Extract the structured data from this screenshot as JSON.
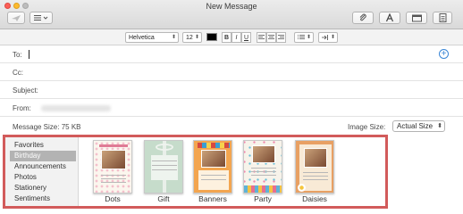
{
  "window": {
    "title": "New Message"
  },
  "toolbar": {
    "send_icon": "paper-plane-icon",
    "header_fields_icon": "list-icon",
    "attach_icon": "paperclip-icon",
    "format_icon": "font-a-icon",
    "photo_browser_icon": "photo-browser-icon",
    "stationery_icon": "stationery-icon"
  },
  "format_bar": {
    "font": "Helvetica",
    "size": "12",
    "color": "#000000",
    "bold": "B",
    "italic": "I",
    "underline": "U"
  },
  "fields": {
    "to_label": "To:",
    "cc_label": "Cc:",
    "subject_label": "Subject:",
    "from_label": "From:"
  },
  "message_size": "Message Size: 75 KB",
  "image_size": {
    "label": "Image Size:",
    "value": "Actual Size"
  },
  "stationery": {
    "categories": [
      {
        "label": "Favorites",
        "selected": false
      },
      {
        "label": "Birthday",
        "selected": true
      },
      {
        "label": "Announcements",
        "selected": false
      },
      {
        "label": "Photos",
        "selected": false
      },
      {
        "label": "Stationery",
        "selected": false
      },
      {
        "label": "Sentiments",
        "selected": false
      }
    ],
    "templates": [
      {
        "label": "Dots"
      },
      {
        "label": "Gift"
      },
      {
        "label": "Banners"
      },
      {
        "label": "Party"
      },
      {
        "label": "Daisies"
      }
    ]
  },
  "colors": {
    "highlight_border": "#d25b5b",
    "accent": "#3a86d6"
  }
}
